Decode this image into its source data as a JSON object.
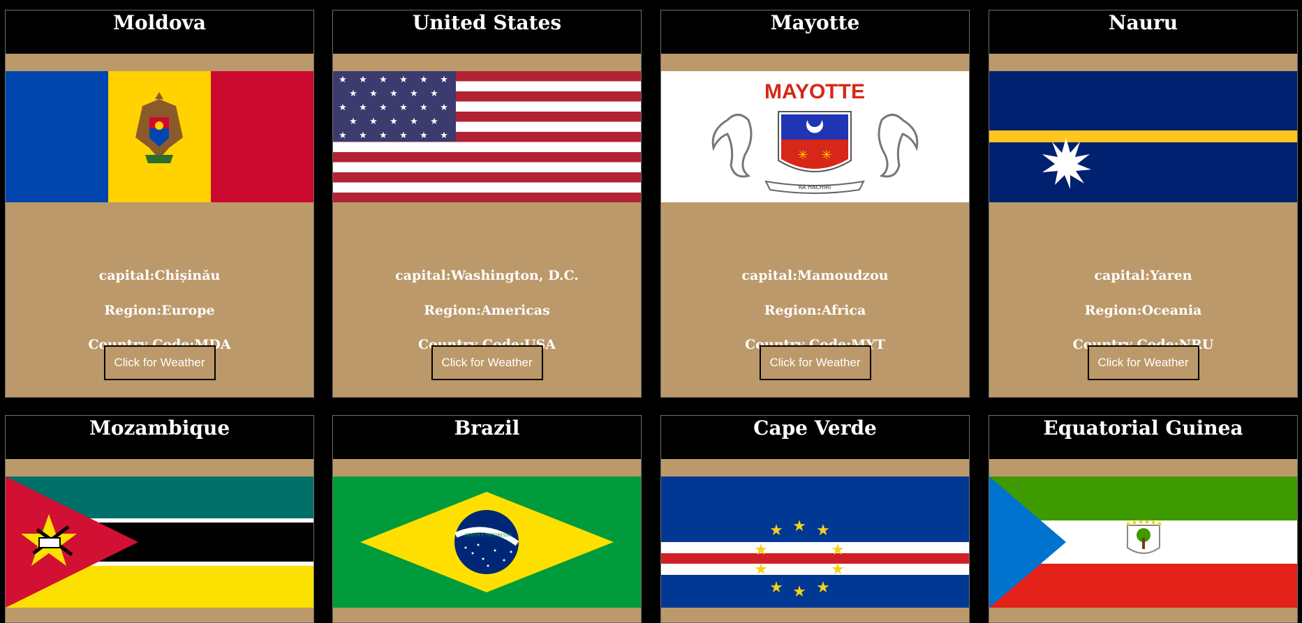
{
  "row1": [
    {
      "name": "Moldova",
      "capital": "capital:Chișinău",
      "region": "Region:Europe",
      "code": "Country Code:MDA",
      "button": "Click for Weather",
      "flag_icon": "moldova-flag"
    },
    {
      "name": "United States",
      "capital": "capital:Washington, D.C.",
      "region": "Region:Americas",
      "code": "Country Code:USA",
      "button": "Click for Weather",
      "flag_icon": "usa-flag"
    },
    {
      "name": "Mayotte",
      "capital": "capital:Mamoudzou",
      "region": "Region:Africa",
      "code": "Country Code:MYT",
      "button": "Click for Weather",
      "flag_icon": "mayotte-flag",
      "flag_text": "MAYOTTE",
      "motto": "RA HACHIRI"
    },
    {
      "name": "Nauru",
      "capital": "capital:Yaren",
      "region": "Region:Oceania",
      "code": "Country Code:NRU",
      "button": "Click for Weather",
      "flag_icon": "nauru-flag"
    }
  ],
  "row2": [
    {
      "name": "Mozambique",
      "flag_icon": "mozambique-flag"
    },
    {
      "name": "Brazil",
      "flag_icon": "brazil-flag",
      "motto": "ORDEM E PROGRESSO"
    },
    {
      "name": "Cape Verde",
      "flag_icon": "cape-verde-flag"
    },
    {
      "name": "Equatorial Guinea",
      "flag_icon": "equatorial-guinea-flag"
    }
  ],
  "colors": {
    "page_bg": "#000000",
    "card_bg": "#bc996a",
    "title_bg": "#000000",
    "text": "#ffffff"
  }
}
